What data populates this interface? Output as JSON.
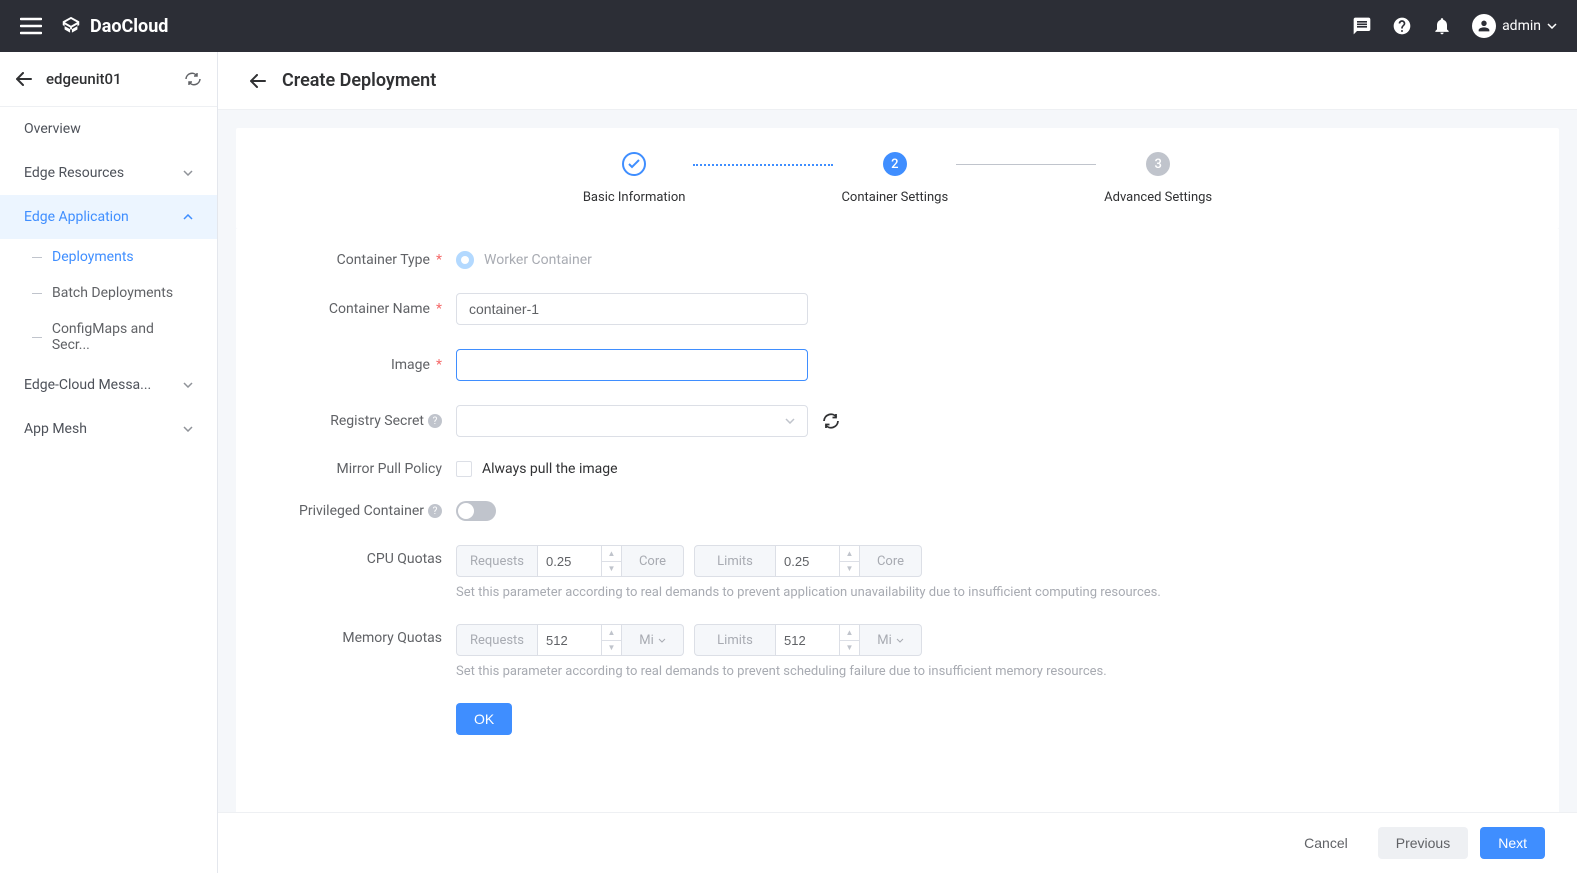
{
  "header": {
    "brand": "DaoCloud",
    "user": "admin"
  },
  "sidebar": {
    "unit": "edgeunit01",
    "items": {
      "overview": "Overview",
      "edge_resources": "Edge Resources",
      "edge_application": "Edge Application",
      "deployments": "Deployments",
      "batch_deployments": "Batch Deployments",
      "configmaps": "ConfigMaps and Secr...",
      "edge_cloud": "Edge-Cloud Messa...",
      "app_mesh": "App Mesh"
    }
  },
  "page": {
    "title": "Create Deployment"
  },
  "steps": {
    "s1": "Basic Information",
    "s2": "Container Settings",
    "s3": "Advanced Settings",
    "n2": "2",
    "n3": "3"
  },
  "form": {
    "container_type": {
      "label": "Container Type",
      "option": "Worker Container"
    },
    "container_name": {
      "label": "Container Name",
      "value": "container-1"
    },
    "image": {
      "label": "Image",
      "value": ""
    },
    "registry_secret": {
      "label": "Registry Secret"
    },
    "mirror_pull": {
      "label": "Mirror Pull Policy",
      "option": "Always pull the image"
    },
    "privileged": {
      "label": "Privileged Container"
    },
    "cpu_quotas": {
      "label": "CPU Quotas",
      "requests_label": "Requests",
      "requests_value": "0.25",
      "limits_label": "Limits",
      "limits_value": "0.25",
      "unit": "Core",
      "helper": "Set this parameter according to real demands to prevent application unavailability due to insufficient computing resources."
    },
    "memory_quotas": {
      "label": "Memory Quotas",
      "requests_label": "Requests",
      "requests_value": "512",
      "limits_label": "Limits",
      "limits_value": "512",
      "unit": "Mi",
      "helper": "Set this parameter according to real demands to prevent scheduling failure due to insufficient memory resources."
    },
    "ok": "OK"
  },
  "footer": {
    "cancel": "Cancel",
    "previous": "Previous",
    "next": "Next"
  }
}
